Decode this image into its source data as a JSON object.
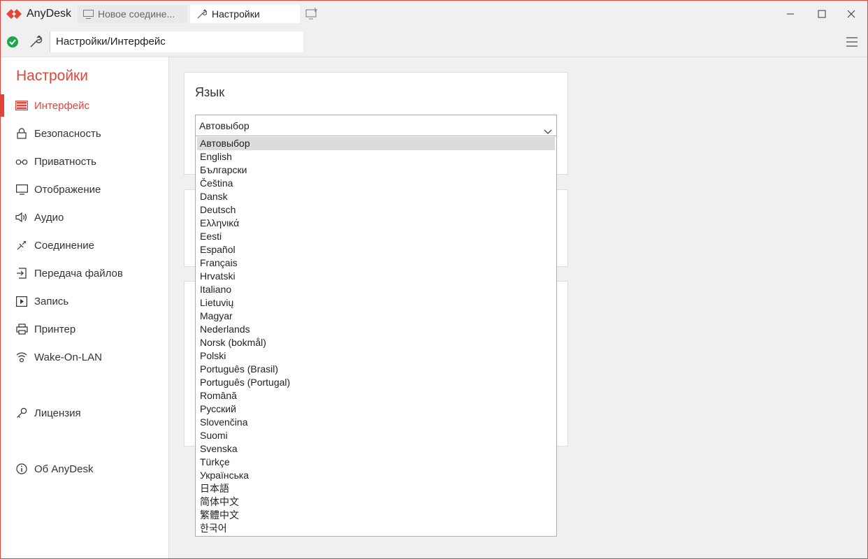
{
  "app": {
    "name": "AnyDesk",
    "brand_color": "#e0453a",
    "status_color": "#1fa64a"
  },
  "tabs": [
    {
      "label": "Новое соедине...",
      "icon": "monitor-icon"
    },
    {
      "label": "Настройки",
      "icon": "wrench-icon"
    }
  ],
  "address": {
    "value": "Настройки/Интерфейс"
  },
  "sidebar": {
    "title": "Настройки",
    "items": [
      {
        "label": "Интерфейс",
        "icon": "interface-icon",
        "active": true
      },
      {
        "label": "Безопасность",
        "icon": "lock-icon"
      },
      {
        "label": "Приватность",
        "icon": "glasses-icon"
      },
      {
        "label": "Отображение",
        "icon": "monitor-icon"
      },
      {
        "label": "Аудио",
        "icon": "speaker-icon"
      },
      {
        "label": "Соединение",
        "icon": "connection-icon"
      },
      {
        "label": "Передача файлов",
        "icon": "file-transfer-icon"
      },
      {
        "label": "Запись",
        "icon": "record-icon"
      },
      {
        "label": "Принтер",
        "icon": "printer-icon"
      },
      {
        "label": "Wake-On-LAN",
        "icon": "wifi-icon"
      },
      {
        "label": "Лицензия",
        "icon": "key-icon"
      },
      {
        "label": "Об AnyDesk",
        "icon": "info-icon"
      }
    ]
  },
  "language": {
    "title": "Язык",
    "selected": "Автовыбор",
    "options": [
      "Автовыбор",
      "English",
      "Български",
      "Čeština",
      "Dansk",
      "Deutsch",
      "Ελληνικά",
      "Eesti",
      "Español",
      "Français",
      "Hrvatski",
      "Italiano",
      "Lietuvių",
      "Magyar",
      "Nederlands",
      "Norsk (bokmål)",
      "Polski",
      "Português (Brasil)",
      "Português (Portugal)",
      "Română",
      "Русский",
      "Slovenčina",
      "Suomi",
      "Svenska",
      "Türkçe",
      "Українська",
      "日本語",
      "简体中文",
      "繁體中文",
      "한국어"
    ]
  }
}
